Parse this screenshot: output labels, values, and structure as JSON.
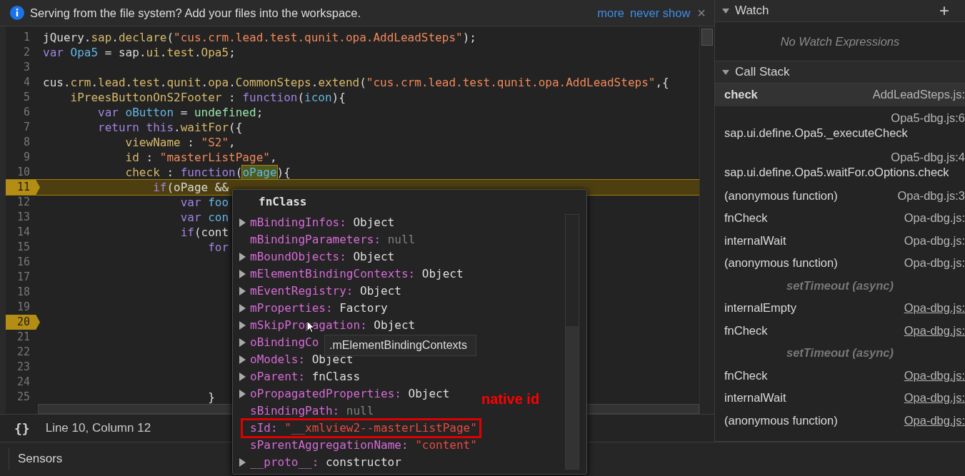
{
  "infobar": {
    "message": "Serving from the file system? Add your files into the workspace.",
    "links": [
      "more",
      "never show"
    ],
    "close": "×"
  },
  "editor": {
    "lines": [
      {
        "number": "1",
        "breakpoint": false,
        "current": false,
        "tokens": [
          {
            "t": "jQuery.",
            "kind": "plain"
          },
          {
            "t": "sap",
            "kind": "prop"
          },
          {
            "t": ".",
            "kind": "plain"
          },
          {
            "t": "declare",
            "kind": "prop"
          },
          {
            "t": "(",
            "kind": "plain"
          },
          {
            "t": "\"cus.crm.lead.test.qunit.opa.AddLeadSteps\"",
            "kind": "string"
          },
          {
            "t": ");",
            "kind": "plain"
          }
        ]
      },
      {
        "number": "2",
        "breakpoint": false,
        "current": false,
        "tokens": [
          {
            "t": "var",
            "kind": "keyword"
          },
          {
            "t": " Opa5",
            "kind": "var"
          },
          {
            "t": " = sap.",
            "kind": "plain"
          },
          {
            "t": "ui",
            "kind": "prop"
          },
          {
            "t": ".",
            "kind": "plain"
          },
          {
            "t": "test",
            "kind": "prop"
          },
          {
            "t": ".",
            "kind": "plain"
          },
          {
            "t": "Opa5",
            "kind": "prop"
          },
          {
            "t": ";",
            "kind": "plain"
          }
        ]
      },
      {
        "number": "3",
        "breakpoint": false,
        "current": false
      },
      {
        "number": "4",
        "breakpoint": false,
        "current": false,
        "tokens": [
          {
            "t": "cus.",
            "kind": "plain"
          },
          {
            "t": "crm",
            "kind": "prop"
          },
          {
            "t": ".",
            "kind": "plain"
          },
          {
            "t": "lead",
            "kind": "prop"
          },
          {
            "t": ".",
            "kind": "plain"
          },
          {
            "t": "test",
            "kind": "prop"
          },
          {
            "t": ".",
            "kind": "plain"
          },
          {
            "t": "qunit",
            "kind": "prop"
          },
          {
            "t": ".",
            "kind": "plain"
          },
          {
            "t": "opa",
            "kind": "prop"
          },
          {
            "t": ".",
            "kind": "plain"
          },
          {
            "t": "CommonSteps",
            "kind": "prop"
          },
          {
            "t": ".",
            "kind": "plain"
          },
          {
            "t": "extend",
            "kind": "prop"
          },
          {
            "t": "(",
            "kind": "plain"
          },
          {
            "t": "\"cus.crm.lead.test.qunit.opa.AddLeadSteps\"",
            "kind": "string"
          },
          {
            "t": ",{",
            "kind": "plain"
          }
        ]
      },
      {
        "number": "5",
        "breakpoint": false,
        "current": false,
        "tokens": [
          {
            "t": "    iPreesButtonOnS2Footer",
            "kind": "prop"
          },
          {
            "t": " : ",
            "kind": "plain"
          },
          {
            "t": "function",
            "kind": "keyword"
          },
          {
            "t": "(",
            "kind": "plain"
          },
          {
            "t": "icon",
            "kind": "var"
          },
          {
            "t": "){",
            "kind": "plain"
          }
        ]
      },
      {
        "number": "6",
        "breakpoint": false,
        "current": false,
        "tokens": [
          {
            "t": "        var",
            "kind": "keyword"
          },
          {
            "t": " oButton",
            "kind": "var"
          },
          {
            "t": " = ",
            "kind": "plain"
          },
          {
            "t": "undefined",
            "kind": "value"
          },
          {
            "t": ";",
            "kind": "plain"
          }
        ]
      },
      {
        "number": "7",
        "breakpoint": false,
        "current": false,
        "tokens": [
          {
            "t": "        return",
            "kind": "keyword"
          },
          {
            "t": " this",
            "kind": "keyword"
          },
          {
            "t": ".",
            "kind": "plain"
          },
          {
            "t": "waitFor",
            "kind": "prop"
          },
          {
            "t": "({",
            "kind": "plain"
          }
        ]
      },
      {
        "number": "8",
        "breakpoint": false,
        "current": false,
        "tokens": [
          {
            "t": "            viewName",
            "kind": "prop"
          },
          {
            "t": " : ",
            "kind": "plain"
          },
          {
            "t": "\"S2\"",
            "kind": "string"
          },
          {
            "t": ",",
            "kind": "plain"
          }
        ]
      },
      {
        "number": "9",
        "breakpoint": false,
        "current": false,
        "tokens": [
          {
            "t": "            id",
            "kind": "prop"
          },
          {
            "t": " : ",
            "kind": "plain"
          },
          {
            "t": "\"masterListPage\"",
            "kind": "string"
          },
          {
            "t": ",",
            "kind": "plain"
          }
        ]
      },
      {
        "number": "10",
        "breakpoint": false,
        "current": false,
        "tokens": [
          {
            "t": "            check",
            "kind": "prop"
          },
          {
            "t": " : ",
            "kind": "plain"
          },
          {
            "t": "function",
            "kind": "keyword"
          },
          {
            "t": "(",
            "kind": "plain"
          },
          {
            "t": "oPage",
            "kind": "highlight"
          },
          {
            "t": "){",
            "kind": "plain"
          }
        ]
      },
      {
        "number": "11",
        "breakpoint": true,
        "current": true,
        "tokens": [
          {
            "t": "                if",
            "kind": "keyword"
          },
          {
            "t": "(oPage &&",
            "kind": "plain"
          }
        ]
      },
      {
        "number": "12",
        "breakpoint": false,
        "current": false,
        "tokens": [
          {
            "t": "                    var",
            "kind": "keyword"
          },
          {
            "t": " foo",
            "kind": "var"
          }
        ]
      },
      {
        "number": "13",
        "breakpoint": false,
        "current": false,
        "tokens": [
          {
            "t": "                    var",
            "kind": "keyword"
          },
          {
            "t": " con",
            "kind": "var"
          }
        ]
      },
      {
        "number": "14",
        "breakpoint": false,
        "current": false,
        "tokens": [
          {
            "t": "                    if",
            "kind": "keyword"
          },
          {
            "t": "(cont",
            "kind": "plain"
          }
        ]
      },
      {
        "number": "15",
        "breakpoint": false,
        "current": false,
        "tokens": [
          {
            "t": "                        for",
            "kind": "keyword"
          }
        ]
      },
      {
        "number": "16",
        "breakpoint": false,
        "current": false
      },
      {
        "number": "17",
        "breakpoint": false,
        "current": false
      },
      {
        "number": "18",
        "breakpoint": false,
        "current": false
      },
      {
        "number": "19",
        "breakpoint": false,
        "current": false
      },
      {
        "number": "20",
        "breakpoint": true,
        "current": false
      },
      {
        "number": "21",
        "breakpoint": false,
        "current": false
      },
      {
        "number": "22",
        "breakpoint": false,
        "current": false
      },
      {
        "number": "23",
        "breakpoint": false,
        "current": false
      },
      {
        "number": "24",
        "breakpoint": false,
        "current": false
      },
      {
        "number": "25",
        "breakpoint": false,
        "current": false,
        "tokens": [
          {
            "t": "                        }",
            "kind": "plain"
          }
        ]
      }
    ]
  },
  "status_bar": {
    "format_button": "{}",
    "position": "Line 10, Column 12"
  },
  "popover": {
    "title": "fnClass",
    "properties": [
      {
        "key": "mBindingInfos:",
        "value": "Object",
        "kind": "object",
        "expandable": true,
        "annotated": false
      },
      {
        "key": "mBindingParameters:",
        "value": "null",
        "kind": "null",
        "expandable": false,
        "annotated": false
      },
      {
        "key": "mBoundObjects:",
        "value": "Object",
        "kind": "object",
        "expandable": true,
        "annotated": false
      },
      {
        "key": "mElementBindingContexts:",
        "value": "Object",
        "kind": "object",
        "expandable": true,
        "annotated": false
      },
      {
        "key": "mEventRegistry:",
        "value": "Object",
        "kind": "object",
        "expandable": true,
        "annotated": false
      },
      {
        "key": "mProperties:",
        "value": "Factory",
        "kind": "object",
        "expandable": true,
        "annotated": false
      },
      {
        "key": "mSkipPropagation:",
        "value": "Object",
        "kind": "object",
        "expandable": true,
        "annotated": false
      },
      {
        "key": "oBindingCo",
        "expandable": true,
        "annotated": false
      },
      {
        "key": "oModels:",
        "value": "Object",
        "kind": "object",
        "expandable": true,
        "annotated": false
      },
      {
        "key": "oParent:",
        "value": "fnClass",
        "kind": "object",
        "expandable": true,
        "annotated": false
      },
      {
        "key": "oPropagatedProperties:",
        "value": "Object",
        "kind": "object",
        "expandable": true,
        "annotated": false
      },
      {
        "key": "sBindingPath:",
        "value": "null",
        "kind": "null",
        "expandable": false,
        "annotated": false
      },
      {
        "key": "sId:",
        "value": "\"__xmlview2--masterListPage\"",
        "kind": "string",
        "expandable": false,
        "annotated": true
      },
      {
        "key": "sParentAggregationName:",
        "value": "\"content\"",
        "kind": "string",
        "expandable": false,
        "annotated": false
      },
      {
        "key": "__proto__:",
        "value": "constructor",
        "kind": "object",
        "expandable": true,
        "annotated": false
      }
    ],
    "tooltip": ".mElementBindingContexts",
    "annotation": "native id"
  },
  "watch": {
    "title": "Watch",
    "expanded": true,
    "add": "+",
    "empty": "No Watch Expressions"
  },
  "call_stack": {
    "title": "Call Stack",
    "expanded": true,
    "frames": [
      {
        "kind": "frame",
        "name": "check",
        "location": "AddLeadSteps.js:",
        "selected": true,
        "linked": false
      },
      {
        "kind": "wrapped",
        "name": "sap.ui.define.Opa5._executeCheck",
        "location": "Opa5-dbg.js:6",
        "selected": false,
        "linked": false
      },
      {
        "kind": "wrapped",
        "name": "sap.ui.define.Opa5.waitFor.oOptions.check",
        "location": "Opa5-dbg.js:4",
        "selected": false,
        "linked": false
      },
      {
        "kind": "frame",
        "name": "(anonymous function)",
        "location": "Opa-dbg.js:3",
        "selected": false,
        "linked": false
      },
      {
        "kind": "frame",
        "name": "fnCheck",
        "location": "Opa-dbg.js:",
        "selected": false,
        "linked": false
      },
      {
        "kind": "frame",
        "name": "internalWait",
        "location": "Opa-dbg.js:",
        "selected": false,
        "linked": false
      },
      {
        "kind": "frame",
        "name": "(anonymous function)",
        "location": "Opa-dbg.js:",
        "selected": false,
        "linked": false
      },
      {
        "kind": "async",
        "name": "setTimeout (async)"
      },
      {
        "kind": "frame",
        "name": "internalEmpty",
        "location": "Opa-dbg.js:",
        "selected": false,
        "linked": true
      },
      {
        "kind": "frame",
        "name": "fnCheck",
        "location": "Opa-dbg.js:",
        "selected": false,
        "linked": true
      },
      {
        "kind": "async",
        "name": "setTimeout (async)"
      },
      {
        "kind": "frame",
        "name": "fnCheck",
        "location": "Opa-dbg.js:",
        "selected": false,
        "linked": true
      },
      {
        "kind": "frame",
        "name": "internalWait",
        "location": "Opa-dbg.js:",
        "selected": false,
        "linked": true
      },
      {
        "kind": "frame",
        "name": "(anonymous function)",
        "location": "Opa-dbg.js:",
        "selected": false,
        "linked": true
      }
    ]
  },
  "drawer": {
    "tabs": [
      {
        "label": "Sensors",
        "selected": true
      }
    ]
  }
}
